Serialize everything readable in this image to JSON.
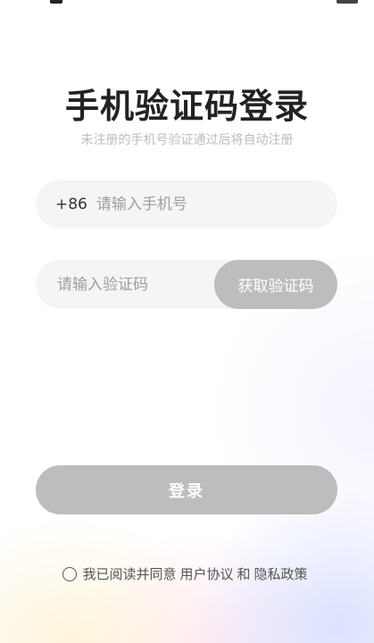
{
  "title": "手机验证码登录",
  "subtitle": "未注册的手机号验证通过后将自动注册",
  "phone": {
    "country_code": "+86",
    "placeholder": "请输入手机号"
  },
  "code": {
    "placeholder": "请输入验证码",
    "get_code_label": "获取验证码"
  },
  "login_label": "登录",
  "agreement": {
    "prefix": "我已阅读并同意",
    "user_agreement": "用户协议",
    "conjunction": "和",
    "privacy_policy": "隐私政策",
    "checked": false
  },
  "colors": {
    "button_disabled": "#bdbdbd",
    "field_background": "#f5f5f5",
    "title": "#222222",
    "subtitle": "#bdbdbd"
  }
}
